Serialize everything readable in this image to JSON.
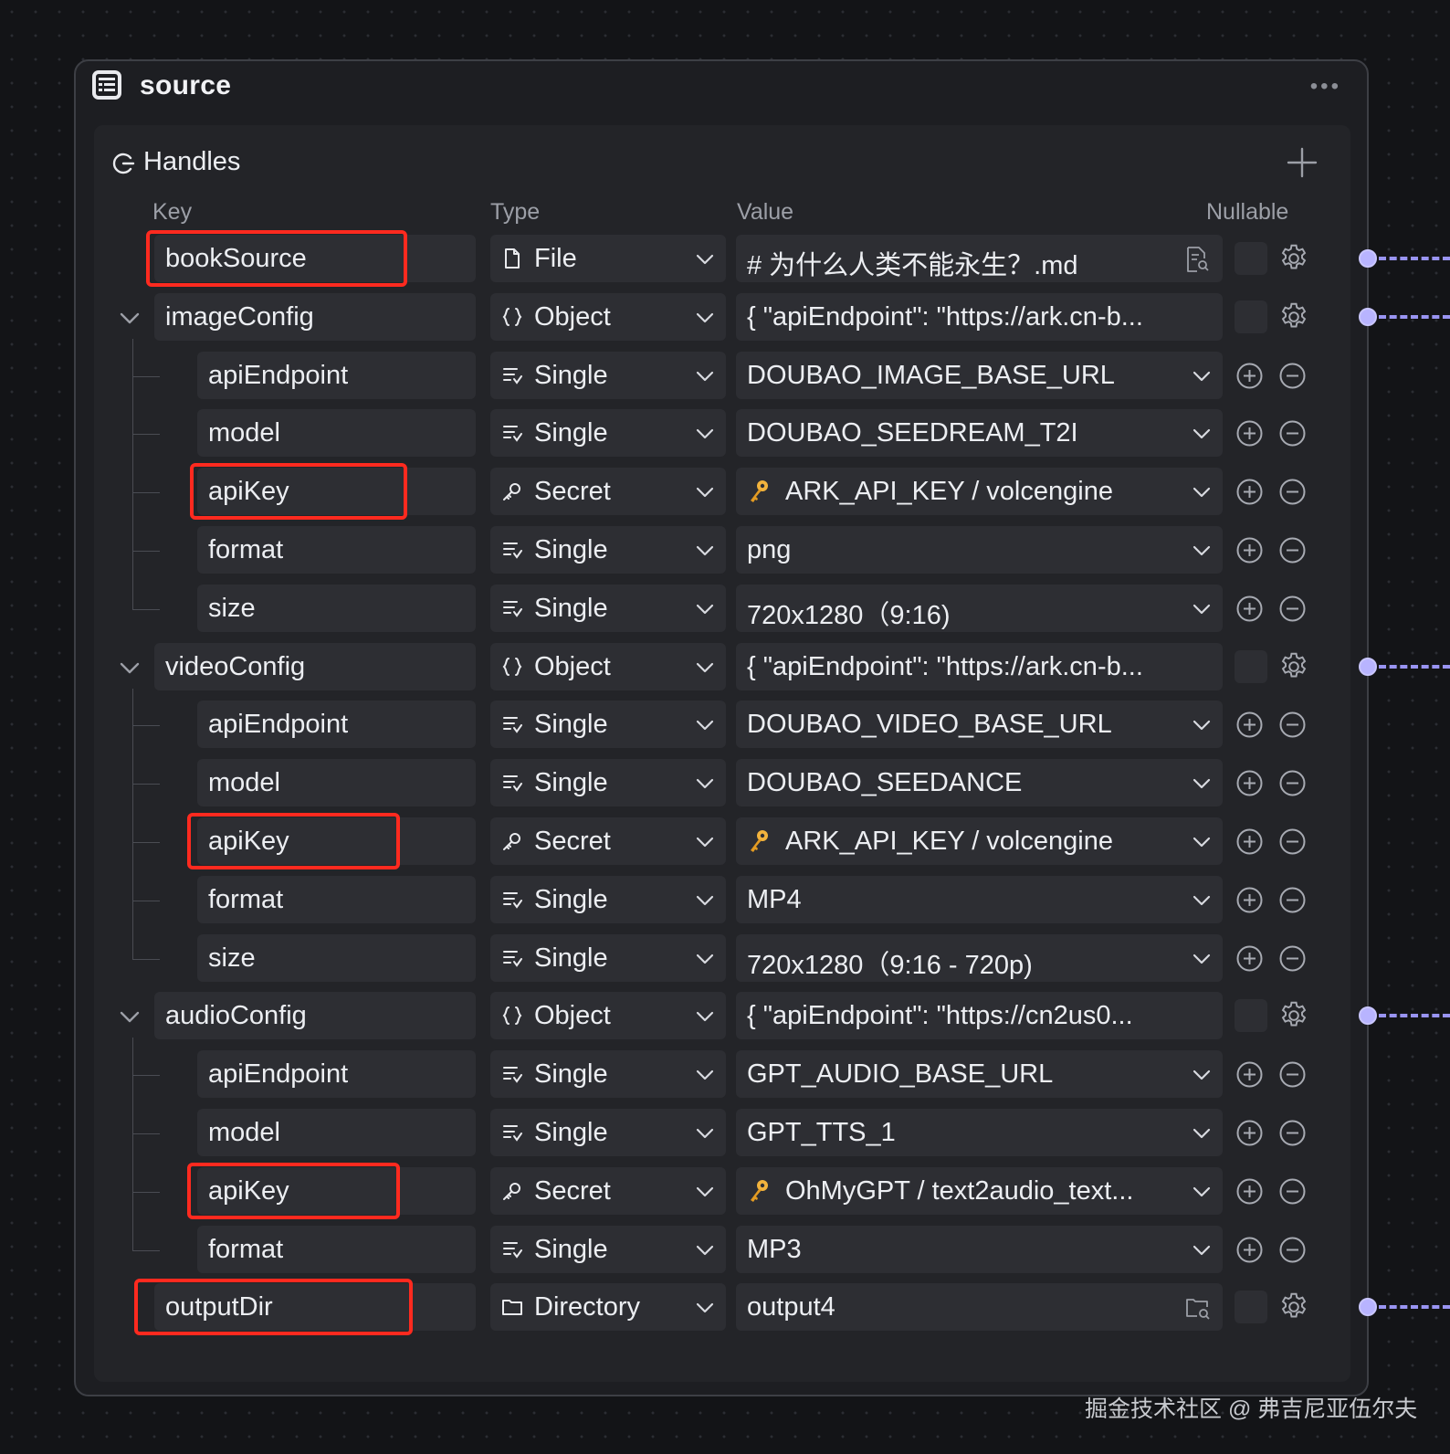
{
  "node": {
    "title": "source"
  },
  "panel": {
    "title": "Handles",
    "columns": {
      "key": "Key",
      "type": "Type",
      "value": "Value",
      "nullable": "Nullable"
    }
  },
  "rows": [
    {
      "key": "bookSource",
      "type": "File",
      "value": "# 为什么人类不能永生？.md"
    },
    {
      "key": "imageConfig",
      "type": "Object",
      "value": "{ \"apiEndpoint\": \"https://ark.cn-b..."
    },
    {
      "key": "apiEndpoint",
      "type": "Single",
      "value": "DOUBAO_IMAGE_BASE_URL"
    },
    {
      "key": "model",
      "type": "Single",
      "value": "DOUBAO_SEEDREAM_T2I"
    },
    {
      "key": "apiKey",
      "type": "Secret",
      "value": "ARK_API_KEY / volcengine"
    },
    {
      "key": "format",
      "type": "Single",
      "value": "png"
    },
    {
      "key": "size",
      "type": "Single",
      "value": "720x1280（9:16)"
    },
    {
      "key": "videoConfig",
      "type": "Object",
      "value": "{ \"apiEndpoint\": \"https://ark.cn-b..."
    },
    {
      "key": "apiEndpoint",
      "type": "Single",
      "value": "DOUBAO_VIDEO_BASE_URL"
    },
    {
      "key": "model",
      "type": "Single",
      "value": "DOUBAO_SEEDANCE"
    },
    {
      "key": "apiKey",
      "type": "Secret",
      "value": "ARK_API_KEY / volcengine"
    },
    {
      "key": "format",
      "type": "Single",
      "value": "MP4"
    },
    {
      "key": "size",
      "type": "Single",
      "value": "720x1280（9:16 - 720p)"
    },
    {
      "key": "audioConfig",
      "type": "Object",
      "value": "{ \"apiEndpoint\": \"https://cn2us0..."
    },
    {
      "key": "apiEndpoint",
      "type": "Single",
      "value": "GPT_AUDIO_BASE_URL"
    },
    {
      "key": "model",
      "type": "Single",
      "value": "GPT_TTS_1"
    },
    {
      "key": "apiKey",
      "type": "Secret",
      "value": "OhMyGPT / text2audio_text..."
    },
    {
      "key": "format",
      "type": "Single",
      "value": "MP3"
    },
    {
      "key": "outputDir",
      "type": "Directory",
      "value": "output4"
    }
  ],
  "watermark": "掘金技术社区 @ 弗吉尼亚伍尔夫",
  "colors": {
    "highlight": "#ff2a1f",
    "port": "#b8b4ff",
    "panel": "#232428"
  }
}
